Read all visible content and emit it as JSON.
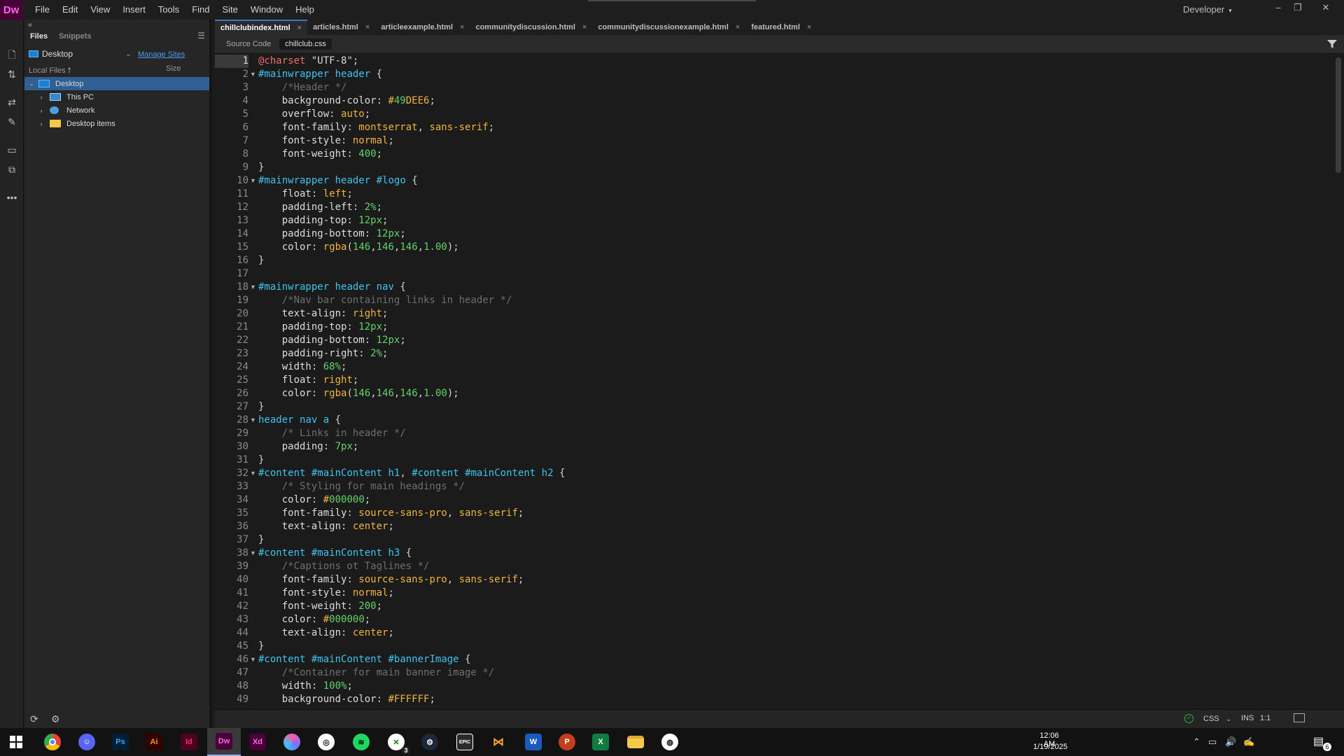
{
  "app": {
    "logo": "Dw"
  },
  "menu": [
    "File",
    "Edit",
    "View",
    "Insert",
    "Tools",
    "Find",
    "Site",
    "Window",
    "Help"
  ],
  "workspace": "Developer",
  "panel": {
    "tabs": [
      "Files",
      "Snippets"
    ],
    "site": "Desktop",
    "manage_sites": "Manage Sites",
    "col_local": "Local Files",
    "col_size": "Size",
    "tree": [
      {
        "label": "Desktop",
        "icon": "desktop-icon",
        "selected": true
      },
      {
        "label": "This PC",
        "icon": "computer-icon"
      },
      {
        "label": "Network",
        "icon": "network-icon"
      },
      {
        "label": "Desktop items",
        "icon": "folder-icon"
      }
    ]
  },
  "doc_tabs": [
    {
      "label": "chillclubindex.html",
      "active": true
    },
    {
      "label": "articles.html"
    },
    {
      "label": "articleexample.html"
    },
    {
      "label": "communitydiscussion.html"
    },
    {
      "label": "communitydiscussionexample.html"
    },
    {
      "label": "featured.html"
    }
  ],
  "related_files": [
    "Source Code",
    "chillclub.css"
  ],
  "code_lines": [
    "@charset \"UTF-8\";",
    "#mainwrapper header {",
    "    /*Header */",
    "    background-color: #49DEE6;",
    "    overflow: auto;",
    "    font-family: montserrat, sans-serif;",
    "    font-style: normal;",
    "    font-weight: 400;",
    "}",
    "#mainwrapper header #logo {",
    "    float: left;",
    "    padding-left: 2%;",
    "    padding-top: 12px;",
    "    padding-bottom: 12px;",
    "    color: rgba(146,146,146,1.00);",
    "}",
    "",
    "#mainwrapper header nav {",
    "    /*Nav bar containing links in header */",
    "    text-align: right;",
    "    padding-top: 12px;",
    "    padding-bottom: 12px;",
    "    padding-right: 2%;",
    "    width: 68%;",
    "    float: right;",
    "    color: rgba(146,146,146,1.00);",
    "}",
    "header nav a {",
    "    /* Links in header */",
    "    padding: 7px;",
    "}",
    "#content #mainContent h1, #content #mainContent h2 {",
    "    /* Styling for main headings */",
    "    color: #000000;",
    "    font-family: source-sans-pro, sans-serif;",
    "    text-align: center;",
    "}",
    "#content #mainContent h3 {",
    "    /*Captions ot Taglines */",
    "    font-family: source-sans-pro, sans-serif;",
    "    font-style: normal;",
    "    font-weight: 200;",
    "    color: #000000;",
    "    text-align: center;",
    "}",
    "#content #mainContent #bannerImage {",
    "    /*Container for main banner image */",
    "    width: 100%;",
    "    background-color: #FFFFFF;"
  ],
  "status": {
    "language": "CSS",
    "mode": "INS",
    "position": "1:1"
  },
  "taskbar": {
    "apps": [
      "start-icon",
      "chrome-icon",
      "discord-icon",
      "photoshop-icon",
      "illustrator-icon",
      "indesign-icon",
      "dreamweaver-icon",
      "xd-icon",
      "vpn-icon",
      "app-icon",
      "spotify-icon",
      "xbox-icon",
      "steam-icon",
      "epic-games-icon",
      "app-icon",
      "word-icon",
      "powerpoint-icon",
      "excel-icon",
      "file-explorer-icon",
      "app-icon"
    ],
    "labels": {
      "photoshop": "Ps",
      "illustrator": "Ai",
      "indesign": "Id",
      "dreamweaver": "Dw",
      "xd": "Xd",
      "epic": "EPIC",
      "word": "W",
      "powerpoint": "P",
      "excel": "X"
    },
    "xbox_badge": "3",
    "time": "12:06 AM",
    "date": "1/19/2025",
    "notifications": "6"
  },
  "colors": {
    "accent": "#3c78c3",
    "selector": "#3ec3ee",
    "value": "#f0b43c",
    "number": "#64d26a",
    "comment": "#6e6e6e"
  }
}
